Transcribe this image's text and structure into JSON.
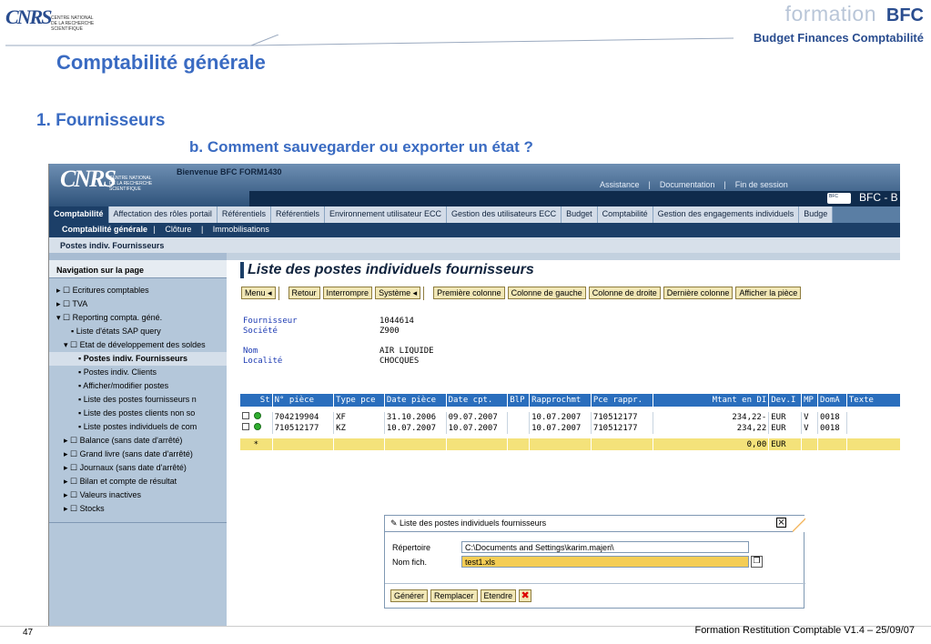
{
  "slide": {
    "logo_text": "CNRS",
    "logo_sub": "CENTRE NATIONAL\nDE LA RECHERCHE\nSCIENTIFIQUE",
    "brand_formation": "formation",
    "brand_bfc": "BFC",
    "brand_sub": "Budget Finances Comptabilité",
    "title": "Comptabilité générale",
    "section": "1. Fournisseurs",
    "subsection": "b. Comment sauvegarder ou exporter un état ?",
    "page_number": "47",
    "footer": "Formation Restitution Comptable V1.4 – 25/09/07"
  },
  "sap": {
    "welcome": "Bienvenue BFC FORM1430",
    "links": [
      "Assistance",
      "|",
      "Documentation",
      "|",
      "Fin de session"
    ],
    "window_title": "BFC - B",
    "badge": "BFC",
    "tabs": [
      "Comptabilité",
      "Affectation des rôles portail",
      "Référentiels",
      "Référentiels",
      "Environnement utilisateur ECC",
      "Gestion des utilisateurs ECC",
      "Budget",
      "Comptabilité",
      "Gestion des engagements individuels",
      "Budge"
    ],
    "subtabs": {
      "active": "Comptabilité générale",
      "sep1": "|",
      "item1": "Clôture",
      "sep2": "|",
      "item2": "Immobilisations"
    },
    "breadcrumb": "Postes indiv. Fournisseurs",
    "nav_title": "Navigation sur la page",
    "nav_items": [
      {
        "label": "▸ ☐ Ecritures comptables",
        "indent": 0
      },
      {
        "label": "▸ ☐ TVA",
        "indent": 0
      },
      {
        "label": "▾ ☐ Reporting compta. géné.",
        "indent": 0
      },
      {
        "label": "▪ Liste d'états SAP query",
        "indent": 2
      },
      {
        "label": "▾ ☐ Etat de développement des soldes",
        "indent": 1
      },
      {
        "label": "▪ Postes indiv. Fournisseurs",
        "indent": 3,
        "bold": true
      },
      {
        "label": "▪ Postes indiv. Clients",
        "indent": 3
      },
      {
        "label": "▪ Afficher/modifier postes",
        "indent": 3
      },
      {
        "label": "▪ Liste des postes fournisseurs n",
        "indent": 3
      },
      {
        "label": "▪ Liste des postes clients non so",
        "indent": 3
      },
      {
        "label": "▪ Liste postes individuels de com",
        "indent": 3
      },
      {
        "label": "▸ ☐ Balance (sans date d'arrêté)",
        "indent": 1
      },
      {
        "label": "▸ ☐ Grand livre (sans date d'arrêté)",
        "indent": 1
      },
      {
        "label": "▸ ☐ Journaux (sans date d'arrêté)",
        "indent": 1
      },
      {
        "label": "▸ ☐ Bilan et compte de résultat",
        "indent": 1
      },
      {
        "label": "▸ ☐ Valeurs inactives",
        "indent": 1
      },
      {
        "label": "▸ ☐ Stocks",
        "indent": 1
      }
    ],
    "page_heading": "Liste des postes individuels fournisseurs",
    "toolbar": [
      "Menu ◂",
      "Retour",
      "Interrompre",
      "Système ◂",
      "Première colonne",
      "Colonne de gauche",
      "Colonne de droite",
      "Dernière colonne",
      "Afficher la pièce"
    ],
    "header_fields": [
      {
        "label": "Fournisseur",
        "value": "1044614"
      },
      {
        "label": "Société",
        "value": "Z900"
      },
      {
        "label": "",
        "value": ""
      },
      {
        "label": "Nom",
        "value": "AIR LIQUIDE"
      },
      {
        "label": "Localité",
        "value": "CHOCQUES"
      }
    ],
    "grid": {
      "columns": [
        "St",
        "N° pièce",
        "Type pce",
        "Date pièce",
        "Date cpt.",
        "BlP",
        "Rapprochmt",
        "Pce rappr.",
        "Mtant en DI",
        "Dev.I",
        "MP",
        "DomA",
        "Texte"
      ],
      "rows": [
        [
          "704219904",
          "XF",
          "31.10.2006",
          "09.07.2007",
          "",
          "10.07.2007",
          "710512177",
          "234,22-",
          "EUR",
          "V",
          "0018",
          ""
        ],
        [
          "710512177",
          "KZ",
          "10.07.2007",
          "10.07.2007",
          "",
          "10.07.2007",
          "710512177",
          "234,22",
          "EUR",
          "V",
          "0018",
          ""
        ]
      ],
      "total": {
        "mark": "*",
        "amount": "0,00",
        "currency": "EUR"
      }
    },
    "dialog": {
      "title": "Liste des postes individuels fournisseurs",
      "close": "⊠",
      "dir_label": "Répertoire",
      "dir_value": "C:\\Documents and Settings\\karim.majeri\\",
      "file_label": "Nom fich.",
      "file_value": "test1.xls",
      "buttons": [
        "Générer",
        "Remplacer",
        "Etendre"
      ],
      "cancel": "✖"
    }
  }
}
